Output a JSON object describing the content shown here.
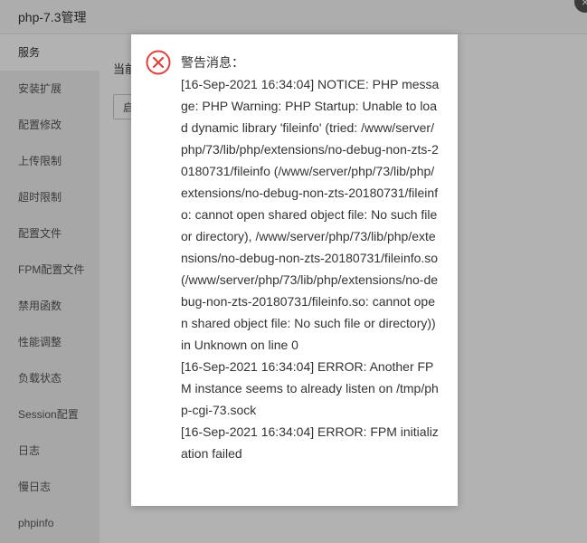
{
  "window": {
    "title": "php-7.3管理",
    "close_icon": "×"
  },
  "sidebar": {
    "items": [
      {
        "label": "服务"
      },
      {
        "label": "安装扩展"
      },
      {
        "label": "配置修改"
      },
      {
        "label": "上传限制"
      },
      {
        "label": "超时限制"
      },
      {
        "label": "配置文件"
      },
      {
        "label": "FPM配置文件"
      },
      {
        "label": "禁用函数"
      },
      {
        "label": "性能调整"
      },
      {
        "label": "负载状态"
      },
      {
        "label": "Session配置"
      },
      {
        "label": "日志"
      },
      {
        "label": "慢日志"
      },
      {
        "label": "phpinfo"
      }
    ]
  },
  "main": {
    "status_label": "当前",
    "action_button": "启"
  },
  "dialog": {
    "heading": "警告消息：",
    "lines": [
      "[16-Sep-2021 16:34:04] NOTICE: PHP message: PHP Warning: PHP Startup: Unable to load dynamic library 'fileinfo' (tried: /www/server/php/73/lib/php/extensions/no-debug-non-zts-20180731/fileinfo (/www/server/php/73/lib/php/extensions/no-debug-non-zts-20180731/fileinfo: cannot open shared object file: No such file or directory), /www/server/php/73/lib/php/extensions/no-debug-non-zts-20180731/fileinfo.so (/www/server/php/73/lib/php/extensions/no-debug-non-zts-20180731/fileinfo.so: cannot open shared object file: No such file or directory)) in Unknown on line 0",
      "[16-Sep-2021 16:34:04] ERROR: Another FPM instance seems to already listen on /tmp/php-cgi-73.sock",
      "[16-Sep-2021 16:34:04] ERROR: FPM initialization failed"
    ],
    "icon": "error-circle-x",
    "icon_color": "#e0413a"
  }
}
